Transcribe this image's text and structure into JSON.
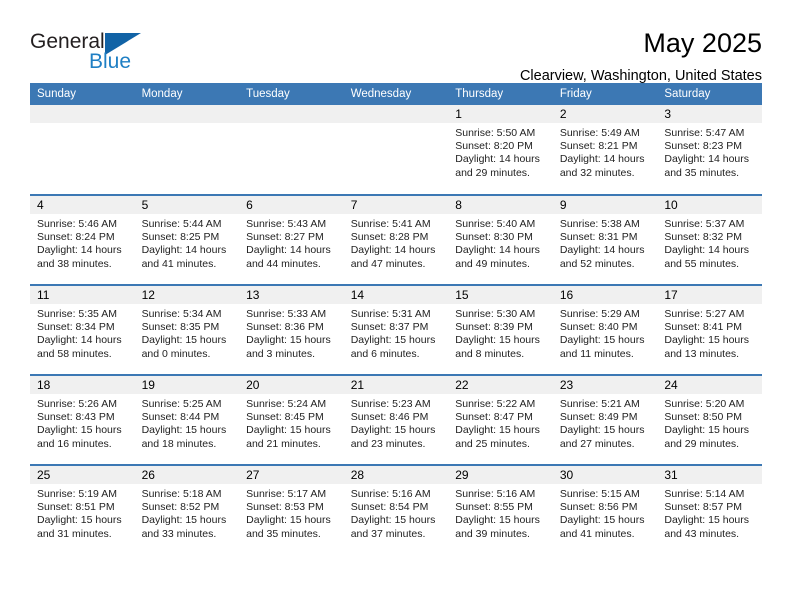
{
  "brand": {
    "name_part1": "General",
    "name_part2": "Blue",
    "triangle_color": "#1163a6",
    "blue_text_color": "#1f7fc4"
  },
  "header": {
    "title": "May 2025",
    "location": "Clearview, Washington, United States"
  },
  "theme": {
    "header_blue": "#3c78b4",
    "daynum_band": "#f0f0f0",
    "text": "#000000"
  },
  "calendar": {
    "weekday_headers": [
      "Sunday",
      "Monday",
      "Tuesday",
      "Wednesday",
      "Thursday",
      "Friday",
      "Saturday"
    ],
    "weeks": [
      [
        {
          "day": "",
          "sunrise": "",
          "sunset": "",
          "daylight_line1": "",
          "daylight_line2": ""
        },
        {
          "day": "",
          "sunrise": "",
          "sunset": "",
          "daylight_line1": "",
          "daylight_line2": ""
        },
        {
          "day": "",
          "sunrise": "",
          "sunset": "",
          "daylight_line1": "",
          "daylight_line2": ""
        },
        {
          "day": "",
          "sunrise": "",
          "sunset": "",
          "daylight_line1": "",
          "daylight_line2": ""
        },
        {
          "day": "1",
          "sunrise": "Sunrise: 5:50 AM",
          "sunset": "Sunset: 8:20 PM",
          "daylight_line1": "Daylight: 14 hours",
          "daylight_line2": "and 29 minutes."
        },
        {
          "day": "2",
          "sunrise": "Sunrise: 5:49 AM",
          "sunset": "Sunset: 8:21 PM",
          "daylight_line1": "Daylight: 14 hours",
          "daylight_line2": "and 32 minutes."
        },
        {
          "day": "3",
          "sunrise": "Sunrise: 5:47 AM",
          "sunset": "Sunset: 8:23 PM",
          "daylight_line1": "Daylight: 14 hours",
          "daylight_line2": "and 35 minutes."
        }
      ],
      [
        {
          "day": "4",
          "sunrise": "Sunrise: 5:46 AM",
          "sunset": "Sunset: 8:24 PM",
          "daylight_line1": "Daylight: 14 hours",
          "daylight_line2": "and 38 minutes."
        },
        {
          "day": "5",
          "sunrise": "Sunrise: 5:44 AM",
          "sunset": "Sunset: 8:25 PM",
          "daylight_line1": "Daylight: 14 hours",
          "daylight_line2": "and 41 minutes."
        },
        {
          "day": "6",
          "sunrise": "Sunrise: 5:43 AM",
          "sunset": "Sunset: 8:27 PM",
          "daylight_line1": "Daylight: 14 hours",
          "daylight_line2": "and 44 minutes."
        },
        {
          "day": "7",
          "sunrise": "Sunrise: 5:41 AM",
          "sunset": "Sunset: 8:28 PM",
          "daylight_line1": "Daylight: 14 hours",
          "daylight_line2": "and 47 minutes."
        },
        {
          "day": "8",
          "sunrise": "Sunrise: 5:40 AM",
          "sunset": "Sunset: 8:30 PM",
          "daylight_line1": "Daylight: 14 hours",
          "daylight_line2": "and 49 minutes."
        },
        {
          "day": "9",
          "sunrise": "Sunrise: 5:38 AM",
          "sunset": "Sunset: 8:31 PM",
          "daylight_line1": "Daylight: 14 hours",
          "daylight_line2": "and 52 minutes."
        },
        {
          "day": "10",
          "sunrise": "Sunrise: 5:37 AM",
          "sunset": "Sunset: 8:32 PM",
          "daylight_line1": "Daylight: 14 hours",
          "daylight_line2": "and 55 minutes."
        }
      ],
      [
        {
          "day": "11",
          "sunrise": "Sunrise: 5:35 AM",
          "sunset": "Sunset: 8:34 PM",
          "daylight_line1": "Daylight: 14 hours",
          "daylight_line2": "and 58 minutes."
        },
        {
          "day": "12",
          "sunrise": "Sunrise: 5:34 AM",
          "sunset": "Sunset: 8:35 PM",
          "daylight_line1": "Daylight: 15 hours",
          "daylight_line2": "and 0 minutes."
        },
        {
          "day": "13",
          "sunrise": "Sunrise: 5:33 AM",
          "sunset": "Sunset: 8:36 PM",
          "daylight_line1": "Daylight: 15 hours",
          "daylight_line2": "and 3 minutes."
        },
        {
          "day": "14",
          "sunrise": "Sunrise: 5:31 AM",
          "sunset": "Sunset: 8:37 PM",
          "daylight_line1": "Daylight: 15 hours",
          "daylight_line2": "and 6 minutes."
        },
        {
          "day": "15",
          "sunrise": "Sunrise: 5:30 AM",
          "sunset": "Sunset: 8:39 PM",
          "daylight_line1": "Daylight: 15 hours",
          "daylight_line2": "and 8 minutes."
        },
        {
          "day": "16",
          "sunrise": "Sunrise: 5:29 AM",
          "sunset": "Sunset: 8:40 PM",
          "daylight_line1": "Daylight: 15 hours",
          "daylight_line2": "and 11 minutes."
        },
        {
          "day": "17",
          "sunrise": "Sunrise: 5:27 AM",
          "sunset": "Sunset: 8:41 PM",
          "daylight_line1": "Daylight: 15 hours",
          "daylight_line2": "and 13 minutes."
        }
      ],
      [
        {
          "day": "18",
          "sunrise": "Sunrise: 5:26 AM",
          "sunset": "Sunset: 8:43 PM",
          "daylight_line1": "Daylight: 15 hours",
          "daylight_line2": "and 16 minutes."
        },
        {
          "day": "19",
          "sunrise": "Sunrise: 5:25 AM",
          "sunset": "Sunset: 8:44 PM",
          "daylight_line1": "Daylight: 15 hours",
          "daylight_line2": "and 18 minutes."
        },
        {
          "day": "20",
          "sunrise": "Sunrise: 5:24 AM",
          "sunset": "Sunset: 8:45 PM",
          "daylight_line1": "Daylight: 15 hours",
          "daylight_line2": "and 21 minutes."
        },
        {
          "day": "21",
          "sunrise": "Sunrise: 5:23 AM",
          "sunset": "Sunset: 8:46 PM",
          "daylight_line1": "Daylight: 15 hours",
          "daylight_line2": "and 23 minutes."
        },
        {
          "day": "22",
          "sunrise": "Sunrise: 5:22 AM",
          "sunset": "Sunset: 8:47 PM",
          "daylight_line1": "Daylight: 15 hours",
          "daylight_line2": "and 25 minutes."
        },
        {
          "day": "23",
          "sunrise": "Sunrise: 5:21 AM",
          "sunset": "Sunset: 8:49 PM",
          "daylight_line1": "Daylight: 15 hours",
          "daylight_line2": "and 27 minutes."
        },
        {
          "day": "24",
          "sunrise": "Sunrise: 5:20 AM",
          "sunset": "Sunset: 8:50 PM",
          "daylight_line1": "Daylight: 15 hours",
          "daylight_line2": "and 29 minutes."
        }
      ],
      [
        {
          "day": "25",
          "sunrise": "Sunrise: 5:19 AM",
          "sunset": "Sunset: 8:51 PM",
          "daylight_line1": "Daylight: 15 hours",
          "daylight_line2": "and 31 minutes."
        },
        {
          "day": "26",
          "sunrise": "Sunrise: 5:18 AM",
          "sunset": "Sunset: 8:52 PM",
          "daylight_line1": "Daylight: 15 hours",
          "daylight_line2": "and 33 minutes."
        },
        {
          "day": "27",
          "sunrise": "Sunrise: 5:17 AM",
          "sunset": "Sunset: 8:53 PM",
          "daylight_line1": "Daylight: 15 hours",
          "daylight_line2": "and 35 minutes."
        },
        {
          "day": "28",
          "sunrise": "Sunrise: 5:16 AM",
          "sunset": "Sunset: 8:54 PM",
          "daylight_line1": "Daylight: 15 hours",
          "daylight_line2": "and 37 minutes."
        },
        {
          "day": "29",
          "sunrise": "Sunrise: 5:16 AM",
          "sunset": "Sunset: 8:55 PM",
          "daylight_line1": "Daylight: 15 hours",
          "daylight_line2": "and 39 minutes."
        },
        {
          "day": "30",
          "sunrise": "Sunrise: 5:15 AM",
          "sunset": "Sunset: 8:56 PM",
          "daylight_line1": "Daylight: 15 hours",
          "daylight_line2": "and 41 minutes."
        },
        {
          "day": "31",
          "sunrise": "Sunrise: 5:14 AM",
          "sunset": "Sunset: 8:57 PM",
          "daylight_line1": "Daylight: 15 hours",
          "daylight_line2": "and 43 minutes."
        }
      ]
    ]
  }
}
